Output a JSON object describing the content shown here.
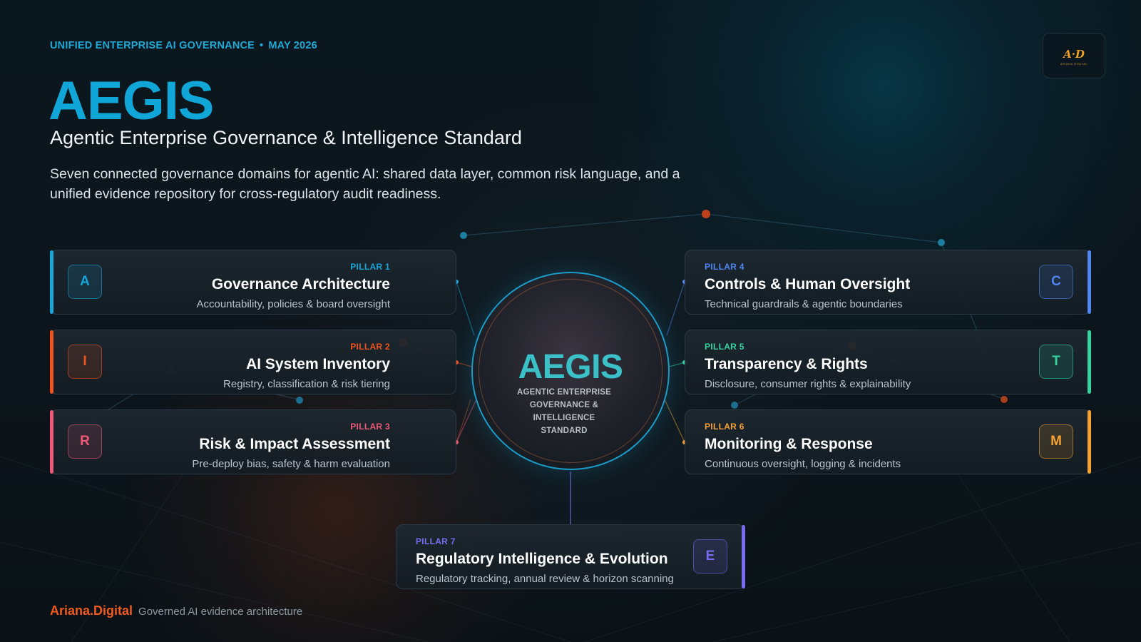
{
  "header": {
    "eyebrow_left": "UNIFIED ENTERPRISE AI GOVERNANCE",
    "eyebrow_sep": "•",
    "eyebrow_right": "MAY 2026",
    "title": "AEGIS",
    "subtitle": "Agentic Enterprise Governance & Intelligence Standard",
    "description": "Seven connected governance domains for agentic AI: shared data layer, common risk language, and a unified evidence repository for cross-regulatory audit readiness."
  },
  "logo": {
    "mark": "A·D",
    "sub": "ARIANA.DIGITAL"
  },
  "hub": {
    "title": "AEGIS",
    "lines": [
      "AGENTIC ENTERPRISE",
      "GOVERNANCE &",
      "INTELLIGENCE",
      "STANDARD"
    ]
  },
  "pillars": [
    {
      "number": "PILLAR 1",
      "letter": "A",
      "title": "Governance Architecture",
      "description": "Accountability, policies & board oversight",
      "color": "#1aa6d9"
    },
    {
      "number": "PILLAR 2",
      "letter": "I",
      "title": "AI System Inventory",
      "description": "Registry, classification & risk tiering",
      "color": "#f0531e"
    },
    {
      "number": "PILLAR 3",
      "letter": "R",
      "title": "Risk & Impact Assessment",
      "description": "Pre-deploy bias, safety & harm evaluation",
      "color": "#f0587a"
    },
    {
      "number": "PILLAR 4",
      "letter": "C",
      "title": "Controls & Human Oversight",
      "description": "Technical guardrails & agentic boundaries",
      "color": "#4f86f0"
    },
    {
      "number": "PILLAR 5",
      "letter": "T",
      "title": "Transparency & Rights",
      "description": "Disclosure, consumer rights & explainability",
      "color": "#34d3a0"
    },
    {
      "number": "PILLAR 6",
      "letter": "M",
      "title": "Monitoring & Response",
      "description": "Continuous oversight, logging & incidents",
      "color": "#f5a232"
    },
    {
      "number": "PILLAR 7",
      "letter": "E",
      "title": "Regulatory Intelligence & Evolution",
      "description": "Regulatory tracking, annual review & horizon scanning",
      "color": "#7a6cf0"
    }
  ],
  "footer": {
    "brand": "Ariana.Digital",
    "tagline": "Governed AI evidence architecture"
  },
  "colors": {
    "accent": "#10a6d8",
    "brand": "#f15a1e",
    "hub_title": "#3bc0c8"
  }
}
